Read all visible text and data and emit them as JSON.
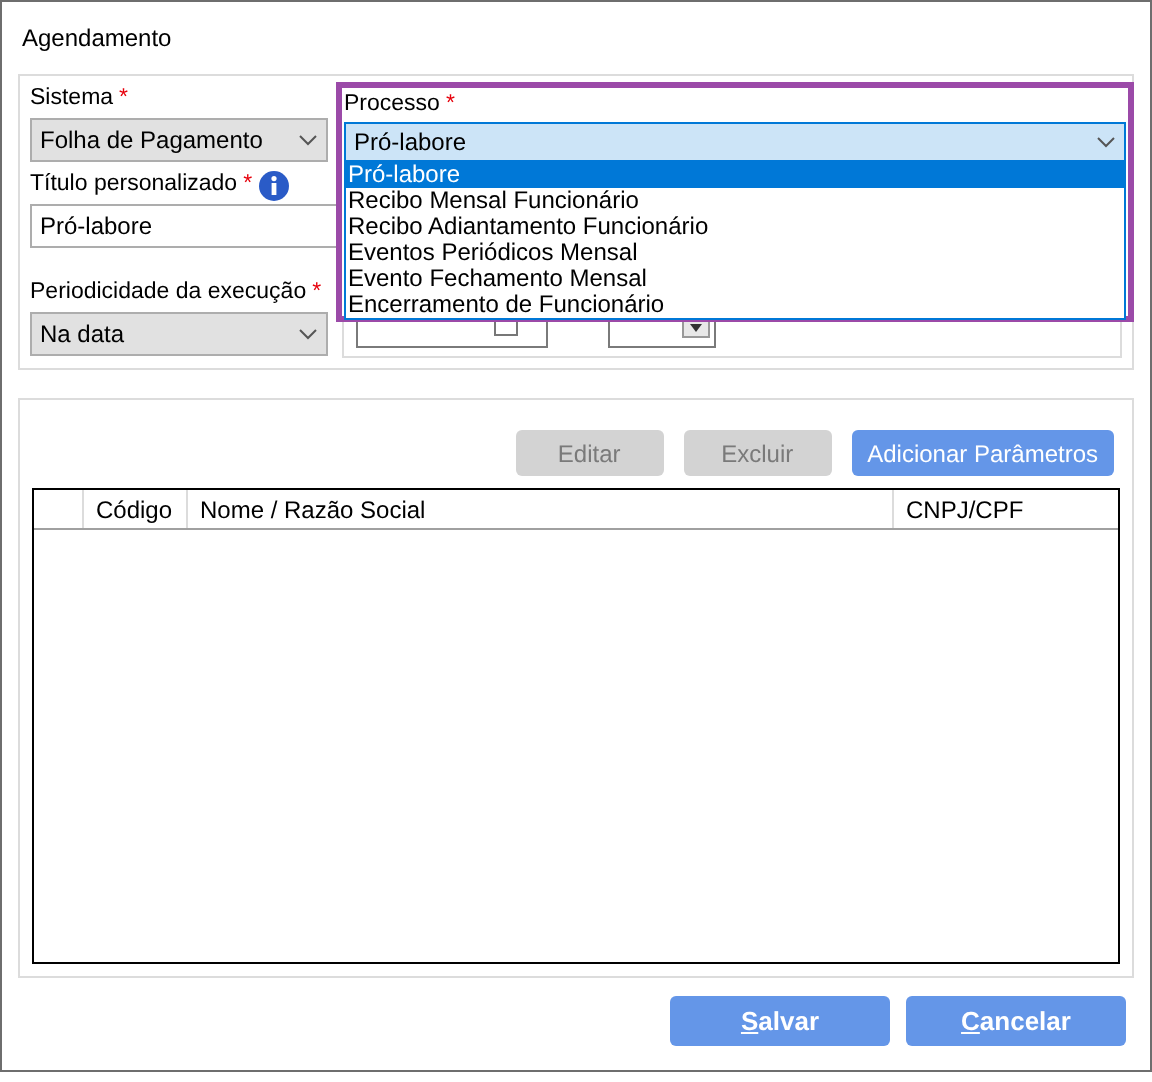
{
  "window": {
    "title": "Agendamento"
  },
  "sistema": {
    "label": "Sistema",
    "required_mark": "*",
    "value": "Folha de Pagamento"
  },
  "titulo": {
    "label": "Título personalizado",
    "required_mark": "*",
    "value": "Pró-labore"
  },
  "periodicidade": {
    "label": "Periodicidade da execução",
    "required_mark": "*",
    "value": "Na data"
  },
  "processo": {
    "label": "Processo",
    "required_mark": "*",
    "value": "Pró-labore",
    "expanded": true,
    "options": [
      {
        "label": "Pró-labore",
        "selected": true
      },
      {
        "label": "Recibo Mensal Funcionário",
        "selected": false
      },
      {
        "label": "Recibo Adiantamento Funcionário",
        "selected": false
      },
      {
        "label": "Eventos Periódicos Mensal",
        "selected": false
      },
      {
        "label": "Evento Fechamento Mensal",
        "selected": false
      },
      {
        "label": "Encerramento de Funcionário",
        "selected": false
      }
    ]
  },
  "toolbar": [
    {
      "label": "Editar",
      "disabled": true
    },
    {
      "label": "Excluir",
      "disabled": true
    },
    {
      "label": "Adicionar Parâmetros",
      "disabled": false
    }
  ],
  "table": {
    "columns": [
      "Código",
      "Nome / Razão Social",
      "CNPJ/CPF"
    ]
  },
  "footer_buttons": [
    {
      "label": "Salvar",
      "mnemonic_underlined": true
    },
    {
      "label": "Cancelar",
      "mnemonic_underlined": true
    }
  ]
}
